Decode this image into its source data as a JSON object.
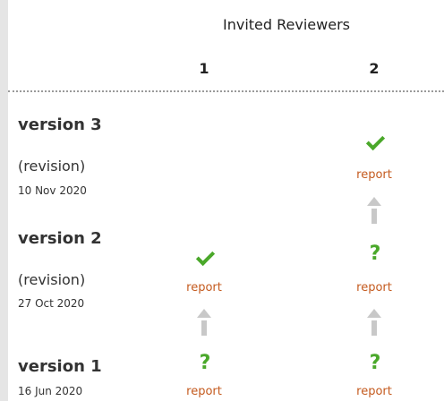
{
  "header": {
    "title": "Invited Reviewers",
    "columns": [
      "1",
      "2"
    ]
  },
  "versions": [
    {
      "title": "version 3",
      "subtitle": "(revision)",
      "date": "10 Nov 2020"
    },
    {
      "title": "version 2",
      "subtitle": "(revision)",
      "date": "27 Oct 2020"
    },
    {
      "title": "version 1",
      "date": "16 Jun 2020"
    }
  ],
  "report_label": "report",
  "question_mark": "?",
  "icons": {
    "approved": "check-icon",
    "reservations": "question-icon",
    "history": "arrow-up-icon"
  },
  "colors": {
    "approved": "#4aa82a",
    "report_link": "#c45a1e",
    "arrow": "#c8c8c8"
  }
}
